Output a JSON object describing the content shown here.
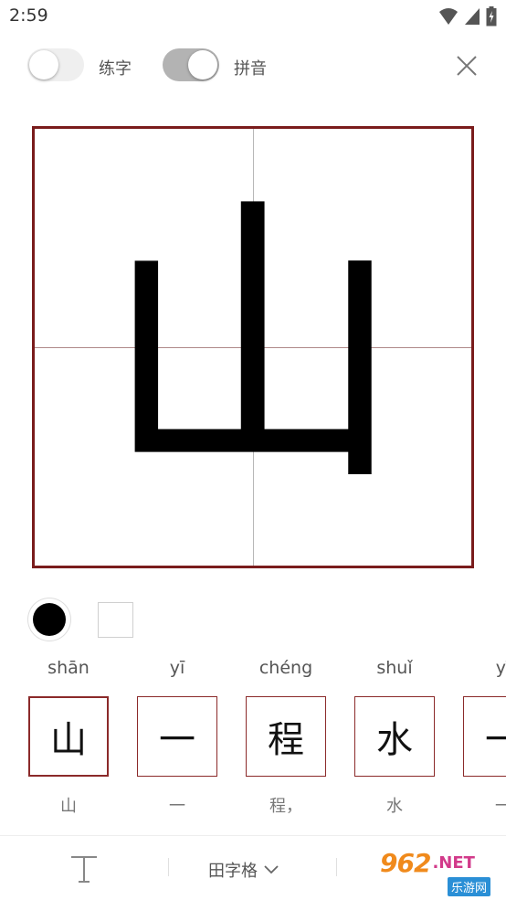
{
  "status": {
    "time": "2:59"
  },
  "toolbar": {
    "practice_label": "练字",
    "pinyin_label": "拼音"
  },
  "board": {
    "character": "山"
  },
  "colors": {
    "accent": "#7a1c1c",
    "ink": "#000000"
  },
  "characters": [
    {
      "pinyin": "shān",
      "char": "山",
      "caption": "山"
    },
    {
      "pinyin": "yī",
      "char": "一",
      "caption": "一"
    },
    {
      "pinyin": "chéng",
      "char": "程",
      "caption": "程，"
    },
    {
      "pinyin": "shuǐ",
      "char": "水",
      "caption": "水"
    },
    {
      "pinyin": "yī",
      "char": "一",
      "caption": "一"
    }
  ],
  "bottom": {
    "grid_label": "田字格"
  },
  "watermark": {
    "number": "962",
    "net": ".NET",
    "site": "乐游网"
  }
}
